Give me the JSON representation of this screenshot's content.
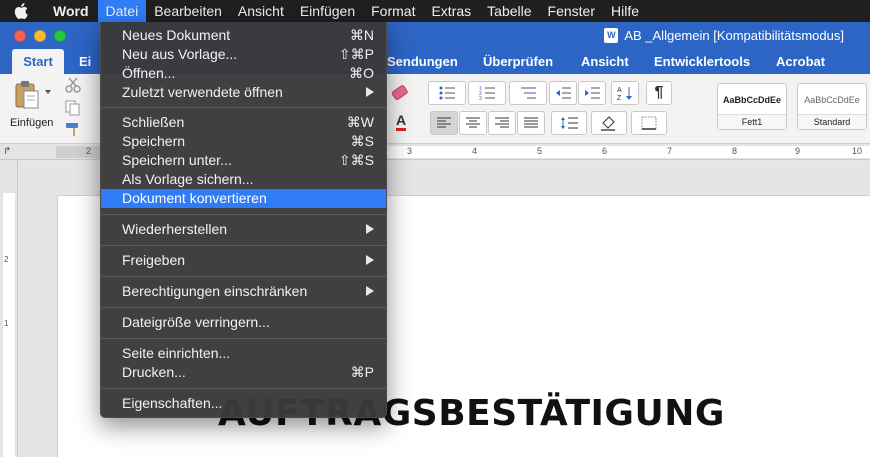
{
  "menubar": {
    "app": "Word",
    "items": [
      "Datei",
      "Bearbeiten",
      "Ansicht",
      "Einfügen",
      "Format",
      "Extras",
      "Tabelle",
      "Fenster",
      "Hilfe"
    ]
  },
  "window": {
    "title": "AB _Allgemein [Kompatibilitätsmodus]",
    "word_icon_letter": "W"
  },
  "ribbon": {
    "tabs": {
      "start": "Start",
      "einfuegen_partial": "Ei",
      "sendungen": "Sendungen",
      "ueberpruefen": "Überprüfen",
      "ansicht": "Ansicht",
      "entwicklertools": "Entwicklertools",
      "acrobat": "Acrobat"
    },
    "paste_label": "Einfügen",
    "styles": [
      {
        "sample": "AaBbCcDdEe",
        "name": "Fett1"
      },
      {
        "sample": "AaBbCcDdEe",
        "name": "Standard"
      }
    ]
  },
  "ruler": {
    "corner": "↱",
    "h_numbers": [
      "2",
      "3",
      "4",
      "5",
      "6",
      "7",
      "8",
      "9",
      "10"
    ],
    "v_numbers": [
      "2",
      "1"
    ]
  },
  "menu": {
    "items": {
      "neues_dokument": {
        "label": "Neues Dokument",
        "shortcut": "⌘N"
      },
      "neu_aus_vorlage": {
        "label": "Neu aus Vorlage...",
        "shortcut": "⇧⌘P"
      },
      "oeffnen": {
        "label": "Öffnen...",
        "shortcut": "⌘O"
      },
      "zuletzt": {
        "label": "Zuletzt verwendete öffnen"
      },
      "schliessen": {
        "label": "Schließen",
        "shortcut": "⌘W"
      },
      "speichern": {
        "label": "Speichern",
        "shortcut": "⌘S"
      },
      "speichern_unter": {
        "label": "Speichern unter...",
        "shortcut": "⇧⌘S"
      },
      "als_vorlage": {
        "label": "Als Vorlage sichern..."
      },
      "konvertieren": {
        "label": "Dokument konvertieren"
      },
      "wiederherstellen": {
        "label": "Wiederherstellen"
      },
      "freigeben": {
        "label": "Freigeben"
      },
      "berechtigungen": {
        "label": "Berechtigungen einschränken"
      },
      "dateigroesse": {
        "label": "Dateigröße verringern..."
      },
      "seite_einrichten": {
        "label": "Seite einrichten..."
      },
      "drucken": {
        "label": "Drucken...",
        "shortcut": "⌘P"
      },
      "eigenschaften": {
        "label": "Eigenschaften..."
      }
    }
  },
  "document": {
    "heading_visible": "AUFTRAGSBESTÄTIGUNG"
  },
  "colors": {
    "ribbon_blue": "#2d65c5",
    "menu_highlight": "#2f7cf6",
    "menu_bg": "#3a3a3c"
  },
  "icons": [
    "apple-icon",
    "word-doc-icon",
    "paste-icon",
    "cut-icon",
    "copy-icon",
    "format-painter-icon",
    "eraser-icon",
    "bullets-icon",
    "numbering-icon",
    "multilevel-icon",
    "outdent-icon",
    "indent-icon",
    "sort-icon",
    "pilcrow-icon",
    "align-left-icon",
    "align-center-icon",
    "align-right-icon",
    "justify-icon",
    "line-spacing-icon",
    "shading-icon",
    "borders-icon",
    "submenu-arrow-icon"
  ]
}
